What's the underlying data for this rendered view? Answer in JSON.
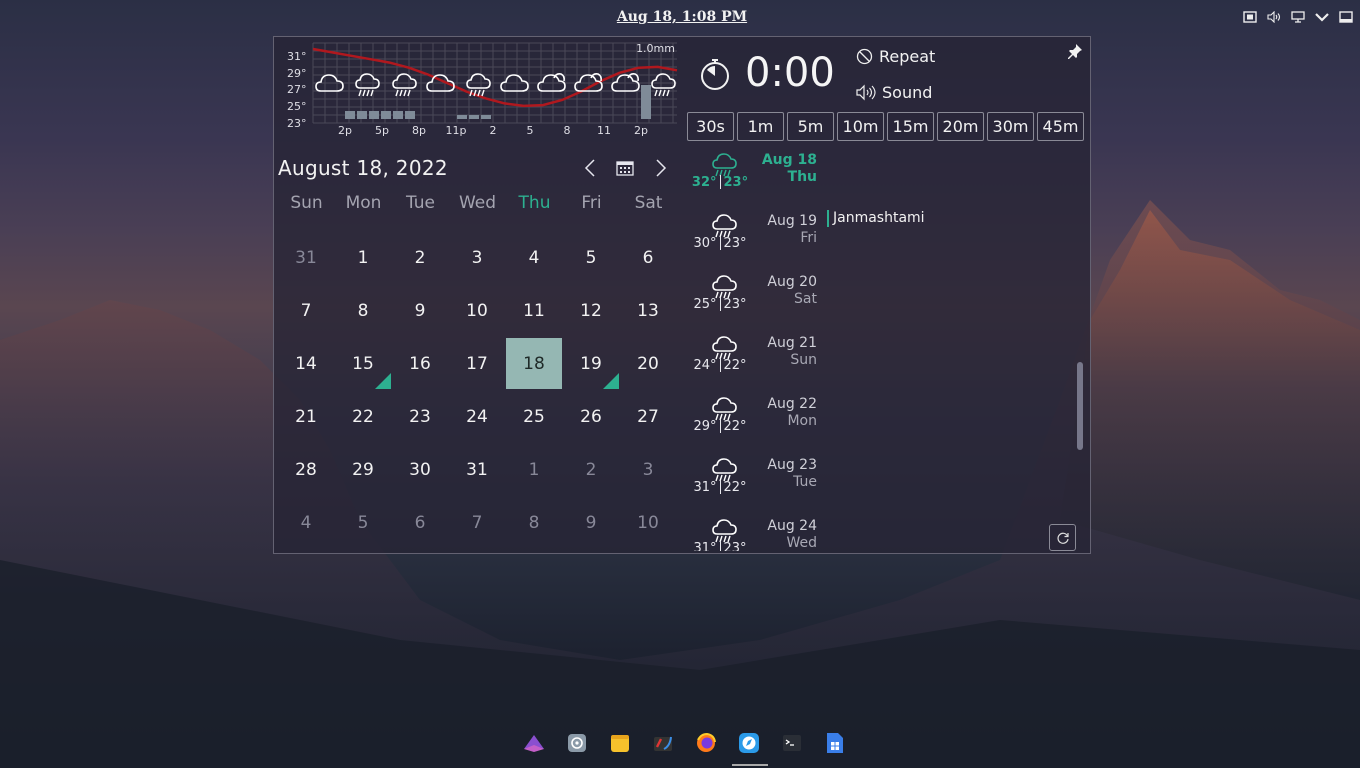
{
  "topbar": {
    "clock": "Aug 18, 1:08 PM",
    "tray_icons": [
      "screenshot-icon",
      "volume-icon",
      "display-icon",
      "chevron-down-icon",
      "window-icon"
    ]
  },
  "weather": {
    "y_ticks": [
      "31°",
      "29°",
      "27°",
      "25°",
      "23°"
    ],
    "x_ticks": [
      "2p",
      "5p",
      "8p",
      "11p",
      "2",
      "5",
      "8",
      "11",
      "2p"
    ],
    "precip_label": "1.0mm",
    "icons": [
      "cloud-icon",
      "rain-icon",
      "rain-icon",
      "cloud-icon",
      "rain-icon",
      "cloud-icon",
      "partly-cloudy-icon",
      "partly-cloudy-icon",
      "partly-cloudy-icon",
      "rain-icon"
    ],
    "temperature_curve": [
      31,
      30.6,
      30.2,
      29.8,
      29.4,
      28.8,
      28.0,
      27.0,
      26.0,
      25.2,
      24.6,
      24.3,
      24.4,
      25.0,
      26.0,
      27.2,
      28.2,
      28.8,
      28.9,
      28.5
    ],
    "temp_color": "#b0181e"
  },
  "calendar": {
    "title": "August 18, 2022",
    "weekdays": [
      "Sun",
      "Mon",
      "Tue",
      "Wed",
      "Thu",
      "Fri",
      "Sat"
    ],
    "today_weekday_index": 4,
    "accent": "#2db090",
    "weeks": [
      [
        "31",
        "1",
        "2",
        "3",
        "4",
        "5",
        "6"
      ],
      [
        "7",
        "8",
        "9",
        "10",
        "11",
        "12",
        "13"
      ],
      [
        "14",
        "15",
        "16",
        "17",
        "18",
        "19",
        "20"
      ],
      [
        "21",
        "22",
        "23",
        "24",
        "25",
        "26",
        "27"
      ],
      [
        "28",
        "29",
        "30",
        "31",
        "1",
        "2",
        "3"
      ],
      [
        "4",
        "5",
        "6",
        "7",
        "8",
        "9",
        "10"
      ]
    ]
  },
  "timer": {
    "time": "0:00",
    "repeat_label": "Repeat",
    "sound_label": "Sound",
    "presets": [
      "30s",
      "1m",
      "5m",
      "10m",
      "15m",
      "20m",
      "30m",
      "45m"
    ]
  },
  "forecast": [
    {
      "date": "Aug 18",
      "dow": "Thu",
      "high": "32°",
      "low": "23°",
      "current": true,
      "event": ""
    },
    {
      "date": "Aug 19",
      "dow": "Fri",
      "high": "30°",
      "low": "23°",
      "current": false,
      "event": "Janmashtami"
    },
    {
      "date": "Aug 20",
      "dow": "Sat",
      "high": "25°",
      "low": "23°",
      "current": false,
      "event": ""
    },
    {
      "date": "Aug 21",
      "dow": "Sun",
      "high": "24°",
      "low": "22°",
      "current": false,
      "event": ""
    },
    {
      "date": "Aug 22",
      "dow": "Mon",
      "high": "29°",
      "low": "22°",
      "current": false,
      "event": ""
    },
    {
      "date": "Aug 23",
      "dow": "Tue",
      "high": "31°",
      "low": "22°",
      "current": false,
      "event": ""
    },
    {
      "date": "Aug 24",
      "dow": "Wed",
      "high": "31°",
      "low": "23°",
      "current": false,
      "event": ""
    }
  ],
  "dock": {
    "items": [
      "app-launcher-icon",
      "settings-app-icon",
      "files-app-icon",
      "code-editor-icon",
      "firefox-icon",
      "browser-icon",
      "terminal-icon",
      "document-app-icon"
    ],
    "active_index": 5
  }
}
